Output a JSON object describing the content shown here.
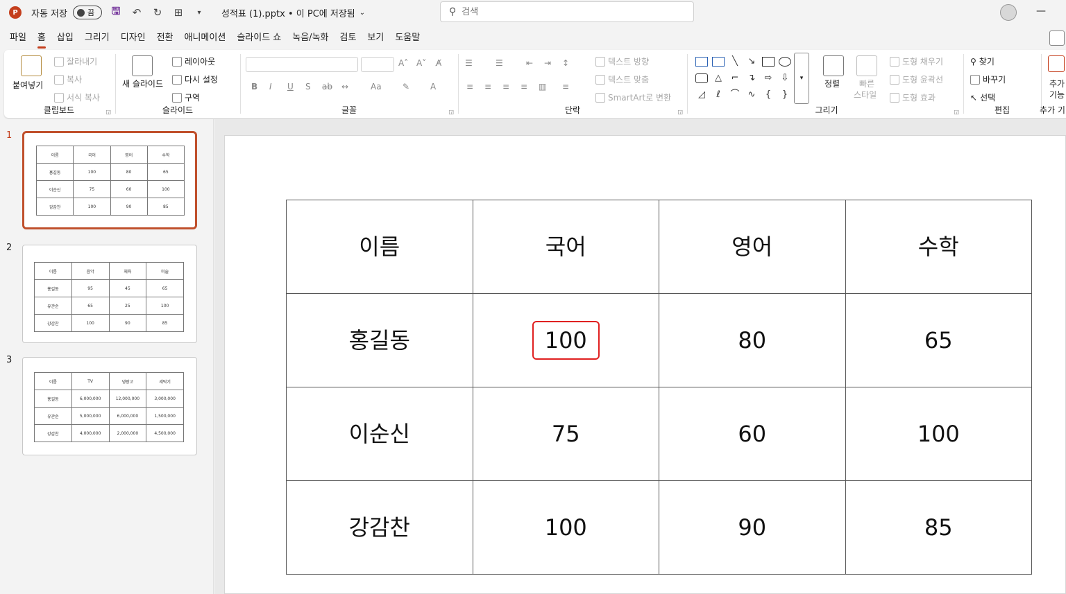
{
  "titlebar": {
    "app_logo": "P",
    "autosave_label": "자동 저장",
    "autosave_state": "끔",
    "doc_title": "성적표 (1).pptx • 이 PC에 저장됨",
    "search_placeholder": "검색"
  },
  "menu": {
    "tabs": [
      "파일",
      "홈",
      "삽입",
      "그리기",
      "디자인",
      "전환",
      "애니메이션",
      "슬라이드 쇼",
      "녹음/녹화",
      "검토",
      "보기",
      "도움말"
    ],
    "active_tab": "홈"
  },
  "ribbon": {
    "clipboard": {
      "paste": "붙여넣기",
      "cut": "잘라내기",
      "copy": "복사",
      "format_painter": "서식 복사",
      "label": "클립보드"
    },
    "slides": {
      "new_slide": "새 슬라이드",
      "layout": "레이아웃",
      "reset": "다시 설정",
      "section": "구역",
      "label": "슬라이드"
    },
    "font": {
      "label": "글꼴"
    },
    "paragraph": {
      "text_direction": "텍스트 방향",
      "align_text": "텍스트 맞춤",
      "smartart": "SmartArt로 변환",
      "label": "단락"
    },
    "drawing": {
      "arrange": "정렬",
      "quick_styles_1": "빠른",
      "quick_styles_2": "스타일",
      "shape_fill": "도형 채우기",
      "shape_outline": "도형 윤곽선",
      "shape_effects": "도형 효과",
      "label": "그리기"
    },
    "editing": {
      "find": "찾기",
      "replace": "바꾸기",
      "select": "선택",
      "label": "편집"
    },
    "addins": {
      "btn_1": "추가",
      "btn_2": "기능",
      "label": "추가 기"
    }
  },
  "thumbnails": [
    {
      "num": "1",
      "rows": [
        [
          "이름",
          "국어",
          "영어",
          "수학"
        ],
        [
          "홍길동",
          "100",
          "80",
          "65"
        ],
        [
          "이순신",
          "75",
          "60",
          "100"
        ],
        [
          "강감찬",
          "100",
          "90",
          "85"
        ]
      ]
    },
    {
      "num": "2",
      "rows": [
        [
          "이름",
          "음악",
          "체육",
          "미술"
        ],
        [
          "홍길동",
          "95",
          "45",
          "65"
        ],
        [
          "유관순",
          "65",
          "25",
          "100"
        ],
        [
          "강감찬",
          "100",
          "90",
          "85"
        ]
      ]
    },
    {
      "num": "3",
      "rows": [
        [
          "이름",
          "TV",
          "냉장고",
          "세탁기"
        ],
        [
          "홍길동",
          "6,000,000",
          "12,000,000",
          "3,000,000"
        ],
        [
          "유관순",
          "5,000,000",
          "6,000,000",
          "1,500,000"
        ],
        [
          "강감찬",
          "4,000,000",
          "2,000,000",
          "4,500,000"
        ]
      ]
    }
  ],
  "slide_table": {
    "rows": [
      [
        "이름",
        "국어",
        "영어",
        "수학"
      ],
      [
        "홍길동",
        "100",
        "80",
        "65"
      ],
      [
        "이순신",
        "75",
        "60",
        "100"
      ],
      [
        "강감찬",
        "100",
        "90",
        "85"
      ]
    ],
    "selected_cell": "1,1",
    "highlight_color": "#e02020"
  }
}
